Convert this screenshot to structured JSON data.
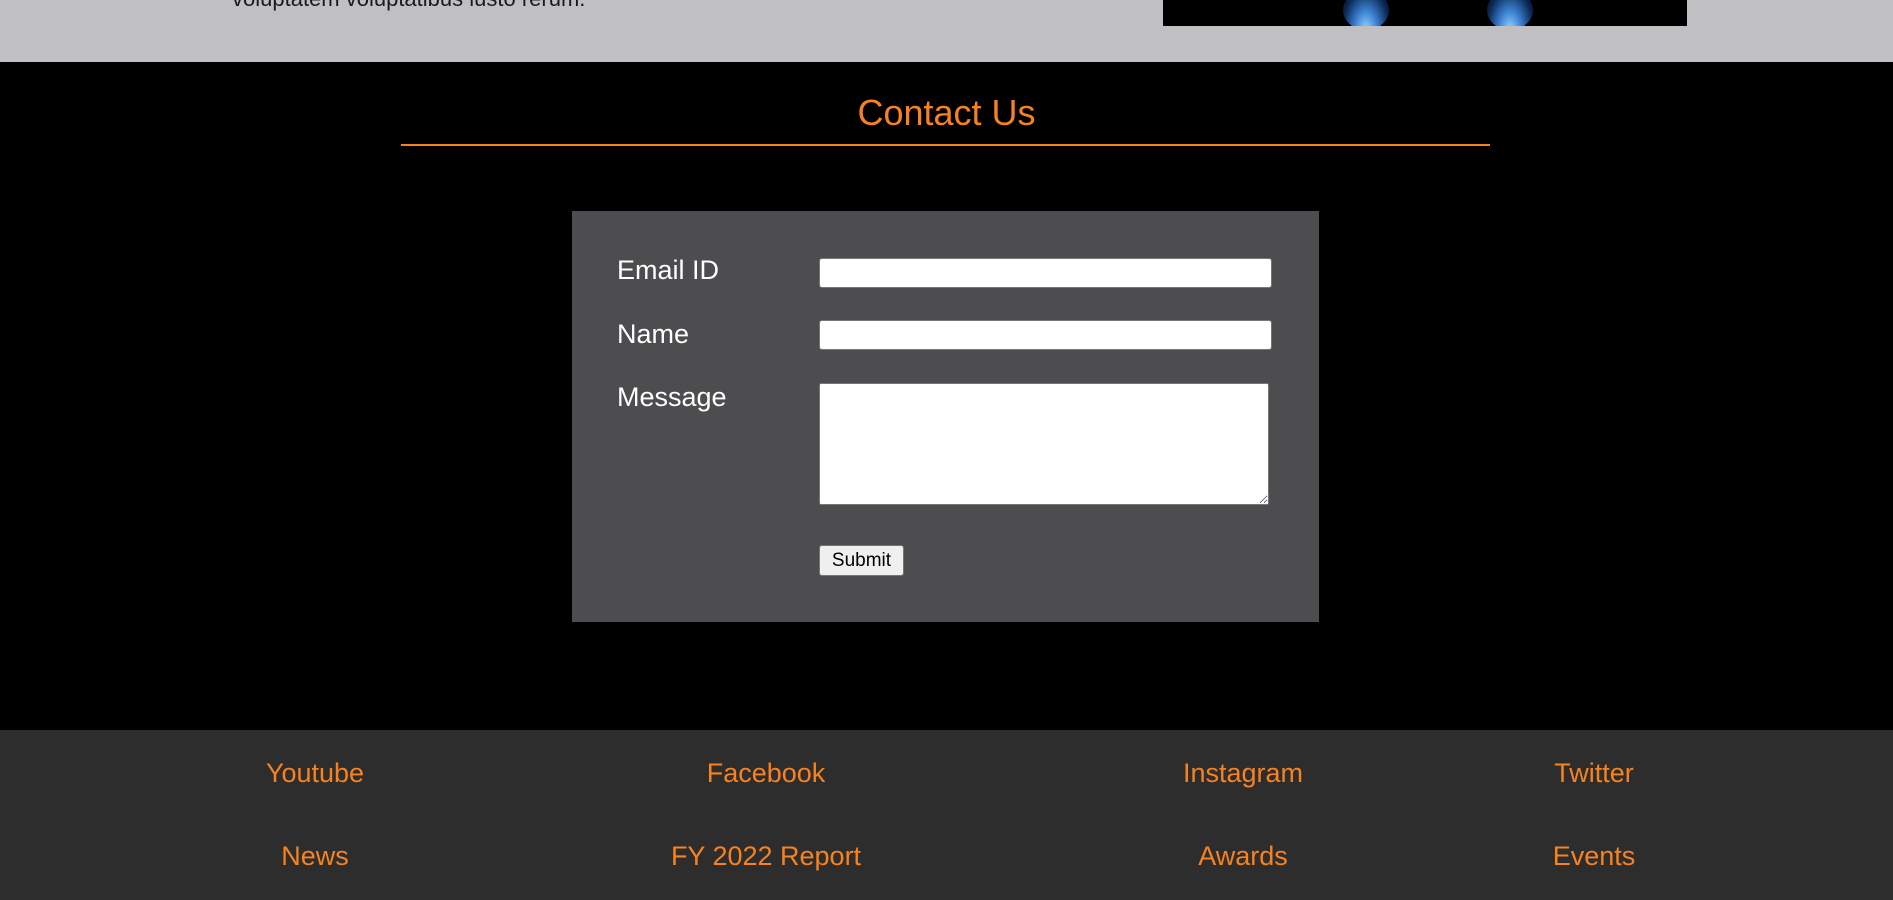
{
  "top_band": {
    "clipped_text": "voluptatem voluptatibus iusto rerum."
  },
  "contact": {
    "title": "Contact Us",
    "form": {
      "email_label": "Email ID",
      "email_value": "",
      "name_label": "Name",
      "name_value": "",
      "message_label": "Message",
      "message_value": "",
      "submit_label": "Submit"
    }
  },
  "footer": {
    "row1": [
      "Youtube",
      "Facebook",
      "Instagram",
      "Twitter"
    ],
    "row2": [
      "News",
      "FY 2022 Report",
      "Awards",
      "Events"
    ]
  },
  "colors": {
    "accent": "#f7821f",
    "page_background": "#000000",
    "top_band": "#c0bfc2",
    "form_panel": "#4d4d4f",
    "footer": "#2d2d2d"
  }
}
